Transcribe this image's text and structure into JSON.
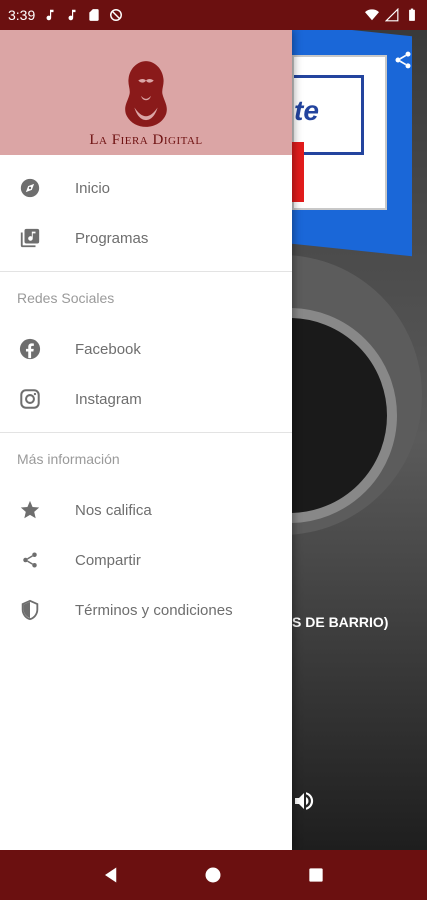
{
  "status_bar": {
    "time": "3:39",
    "left_icons": [
      "music-note-icon",
      "music-note-icon",
      "sd-card-icon",
      "no-disturb-icon"
    ],
    "right_icons": [
      "wifi-icon",
      "signal-icon",
      "battery-icon"
    ],
    "color": "#6b1010"
  },
  "player": {
    "cover_text": "te",
    "track_title_partial": "S DE BARRIO)"
  },
  "drawer": {
    "brand": "La Fiera Digital",
    "header_color": "#dba5a5",
    "main_items": [
      {
        "label": "Inicio",
        "icon": "compass-icon"
      },
      {
        "label": "Programas",
        "icon": "library-music-icon"
      }
    ],
    "social": {
      "title": "Redes Sociales",
      "items": [
        {
          "label": "Facebook",
          "icon": "facebook-icon"
        },
        {
          "label": "Instagram",
          "icon": "instagram-icon"
        }
      ]
    },
    "more": {
      "title": "Más información",
      "items": [
        {
          "label": "Nos califica",
          "icon": "star-icon"
        },
        {
          "label": "Compartir",
          "icon": "share-icon"
        },
        {
          "label": "Términos y condiciones",
          "icon": "shield-icon"
        }
      ]
    }
  },
  "nav_bar": {
    "buttons": [
      "back-icon",
      "home-icon",
      "recents-icon"
    ]
  }
}
